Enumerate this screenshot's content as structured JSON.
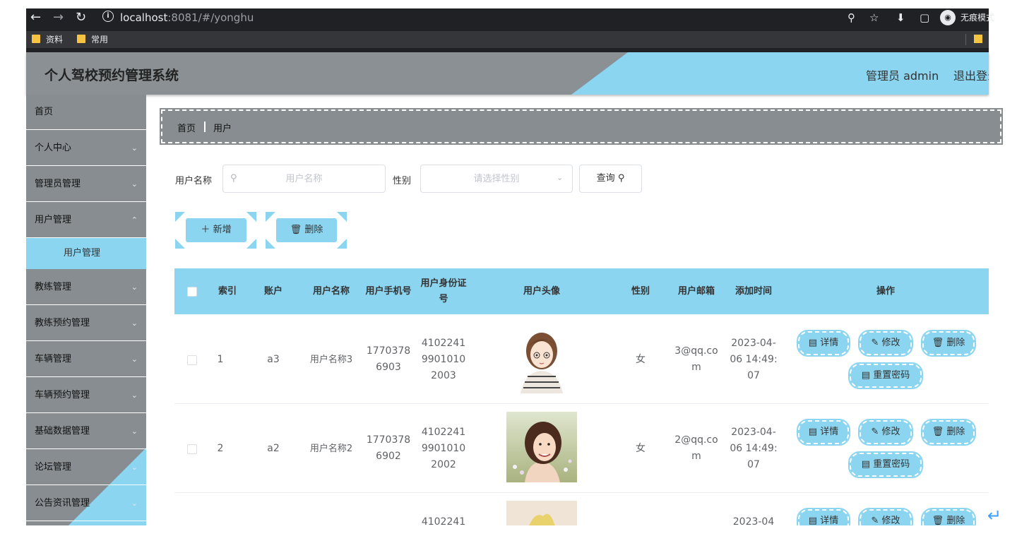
{
  "browser": {
    "url_host": "localhost",
    "url_path": ":8081/#/yonghu",
    "incognito_label": "无痕模式",
    "bookmarks": [
      "资料",
      "常用"
    ]
  },
  "header": {
    "title": "个人驾校预约管理系统",
    "user": "管理员 admin",
    "logout": "退出登录"
  },
  "sidebar": {
    "items": [
      {
        "label": "首页",
        "has_children": false
      },
      {
        "label": "个人中心",
        "has_children": true
      },
      {
        "label": "管理员管理",
        "has_children": true
      },
      {
        "label": "用户管理",
        "has_children": true
      },
      {
        "label": "教练管理",
        "has_children": true
      },
      {
        "label": "教练预约管理",
        "has_children": true
      },
      {
        "label": "车辆管理",
        "has_children": true
      },
      {
        "label": "车辆预约管理",
        "has_children": true
      },
      {
        "label": "基础数据管理",
        "has_children": true
      },
      {
        "label": "论坛管理",
        "has_children": true
      },
      {
        "label": "公告资讯管理",
        "has_children": true
      }
    ],
    "active_sub": "用户管理"
  },
  "breadcrumb": {
    "home": "首页",
    "current": "用户"
  },
  "search": {
    "name_label": "用户名称",
    "name_placeholder": "用户名称",
    "gender_label": "性别",
    "gender_placeholder": "请选择性别",
    "query_button": "查询"
  },
  "actions": {
    "add": "新增",
    "delete": "删除"
  },
  "table": {
    "headers": {
      "index": "索引",
      "account": "账户",
      "name": "用户名称",
      "phone": "用户手机号",
      "idcard": "用户身份证号",
      "avatar": "用户头像",
      "gender": "性别",
      "email": "用户邮箱",
      "added": "添加时间",
      "ops": "操作"
    },
    "rows": [
      {
        "index": "1",
        "account": "a3",
        "name": "用户名称3",
        "phone": "17703786903",
        "idcard": "410224199010102003",
        "gender": "女",
        "email": "3@qq.com",
        "added": "2023-04-06 14:49:07"
      },
      {
        "index": "2",
        "account": "a2",
        "name": "用户名称2",
        "phone": "17703786902",
        "idcard": "410224199010102002",
        "gender": "女",
        "email": "2@qq.com",
        "added": "2023-04-06 14:49:07"
      },
      {
        "index": "",
        "account": "",
        "name": "",
        "phone": "",
        "idcard": "4102241",
        "gender": "",
        "email": "",
        "added": "2023-04"
      }
    ],
    "row_ops": {
      "detail": "详情",
      "edit": "修改",
      "delete": "删除",
      "reset": "重置密码"
    }
  },
  "colors": {
    "accent": "#8cd5f0",
    "gray": "#878d90",
    "header_gray": "#8a9093"
  }
}
